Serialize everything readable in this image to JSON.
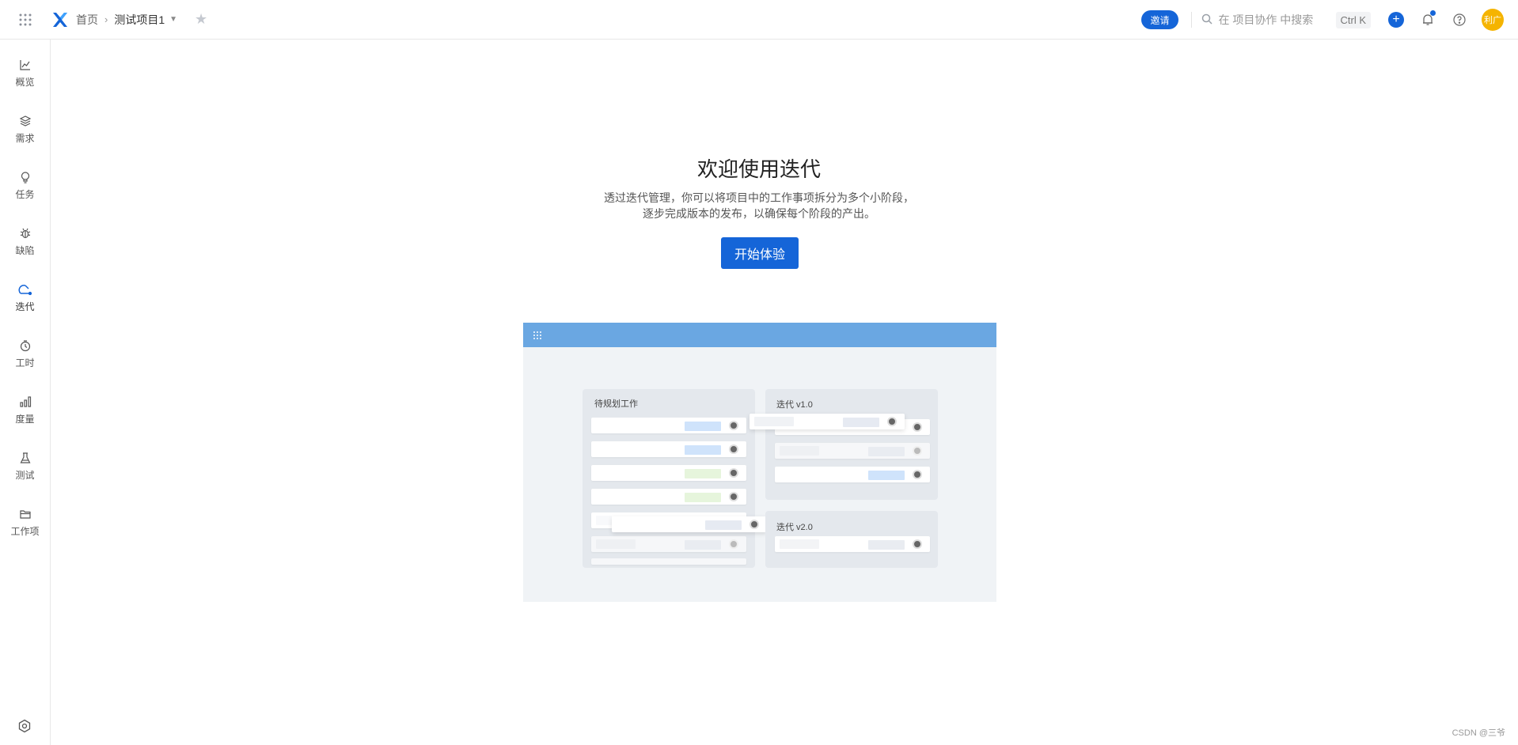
{
  "topbar": {
    "home_label": "首页",
    "project_name": "测试项目1",
    "invite_label": "邀请",
    "search_placeholder": "在 项目协作 中搜索",
    "shortcut": "Ctrl K",
    "avatar_text": "利广"
  },
  "sidebar": {
    "items": [
      {
        "label": "概览",
        "icon": "chart-line-icon"
      },
      {
        "label": "需求",
        "icon": "layers-icon"
      },
      {
        "label": "任务",
        "icon": "lightbulb-icon"
      },
      {
        "label": "缺陷",
        "icon": "bug-icon"
      },
      {
        "label": "迭代",
        "icon": "iteration-icon",
        "active": true
      },
      {
        "label": "工时",
        "icon": "clock-icon"
      },
      {
        "label": "度量",
        "icon": "bar-chart-icon"
      },
      {
        "label": "测试",
        "icon": "flask-icon"
      },
      {
        "label": "工作项",
        "icon": "folder-icon"
      }
    ]
  },
  "main": {
    "title": "欢迎使用迭代",
    "desc_line1": "透过迭代管理，你可以将项目中的工作事项拆分为多个小阶段，",
    "desc_line2": "逐步完成版本的发布，以确保每个阶段的产出。",
    "start_button": "开始体验"
  },
  "illustration": {
    "backlog_title": "待规划工作",
    "sprint1_title": "迭代 v1.0",
    "sprint2_title": "迭代 v2.0"
  },
  "footer": {
    "watermark": "CSDN @三爷"
  },
  "colors": {
    "accent": "#1565d8",
    "illus_header": "#6aa7e2",
    "avatar": "#f5b400"
  }
}
